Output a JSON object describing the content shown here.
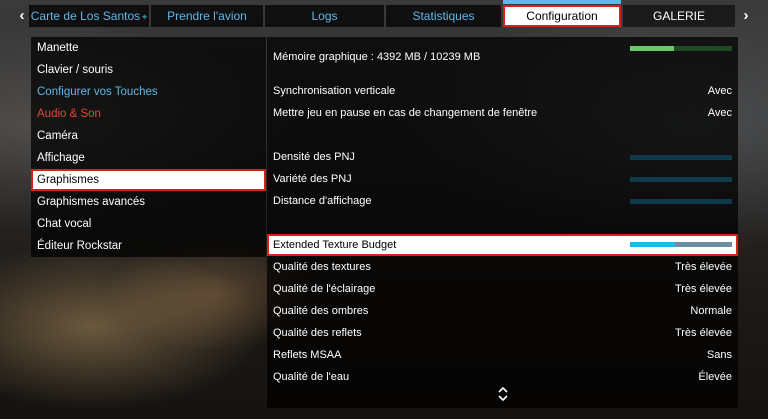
{
  "nav": {
    "left_arrow": "‹",
    "right_arrow": "›",
    "tabs": [
      {
        "label": "Carte de Los Santos",
        "icon": "map-marker-icon"
      },
      {
        "label": "Prendre l'avion"
      },
      {
        "label": "Logs"
      },
      {
        "label": "Statistiques"
      },
      {
        "label": "Configuration",
        "active": true
      },
      {
        "label": "GALERIE"
      }
    ]
  },
  "menu": {
    "items": [
      {
        "label": "Manette"
      },
      {
        "label": "Clavier / souris"
      },
      {
        "label": "Configurer vos Touches",
        "color": "#5fb8ea"
      },
      {
        "label": "Audio & Son",
        "color": "#e0483c"
      },
      {
        "label": "Caméra"
      },
      {
        "label": "Affichage"
      },
      {
        "label": "Graphismes",
        "selected": true
      },
      {
        "label": "Graphismes avancés"
      },
      {
        "label": "Chat vocal"
      },
      {
        "label": "Éditeur Rockstar"
      }
    ]
  },
  "settings": {
    "memory": {
      "label": "Mémoire graphique : 4392 MB / 10239 MB",
      "used_fraction": 0.43
    },
    "vsync": {
      "label": "Synchronisation verticale",
      "value": "Avec"
    },
    "pause": {
      "label": "Mettre jeu en pause en cas de changement de fenêtre",
      "value": "Avec"
    },
    "pnj_density": {
      "label": "Densité des PNJ"
    },
    "pnj_variety": {
      "label": "Variété des PNJ"
    },
    "draw_distance": {
      "label": "Distance d'affichage"
    },
    "texture_budget": {
      "label": "Extended Texture Budget",
      "level_fraction": 0.44
    },
    "textures": {
      "label": "Qualité des textures",
      "value": "Très élevée"
    },
    "lighting": {
      "label": "Qualité de l'éclairage",
      "value": "Très élevée"
    },
    "shadows": {
      "label": "Qualité des ombres",
      "value": "Normale"
    },
    "reflections": {
      "label": "Qualité des reflets",
      "value": "Très élevée"
    },
    "msaa": {
      "label": "Reflets MSAA",
      "value": "Sans"
    },
    "water": {
      "label": "Qualité de l'eau",
      "value": "Élevée"
    }
  },
  "colors": {
    "accent_blue": "#5fb8ea",
    "highlight_red": "#d81e1e",
    "memory_green": "#6cc86c"
  }
}
